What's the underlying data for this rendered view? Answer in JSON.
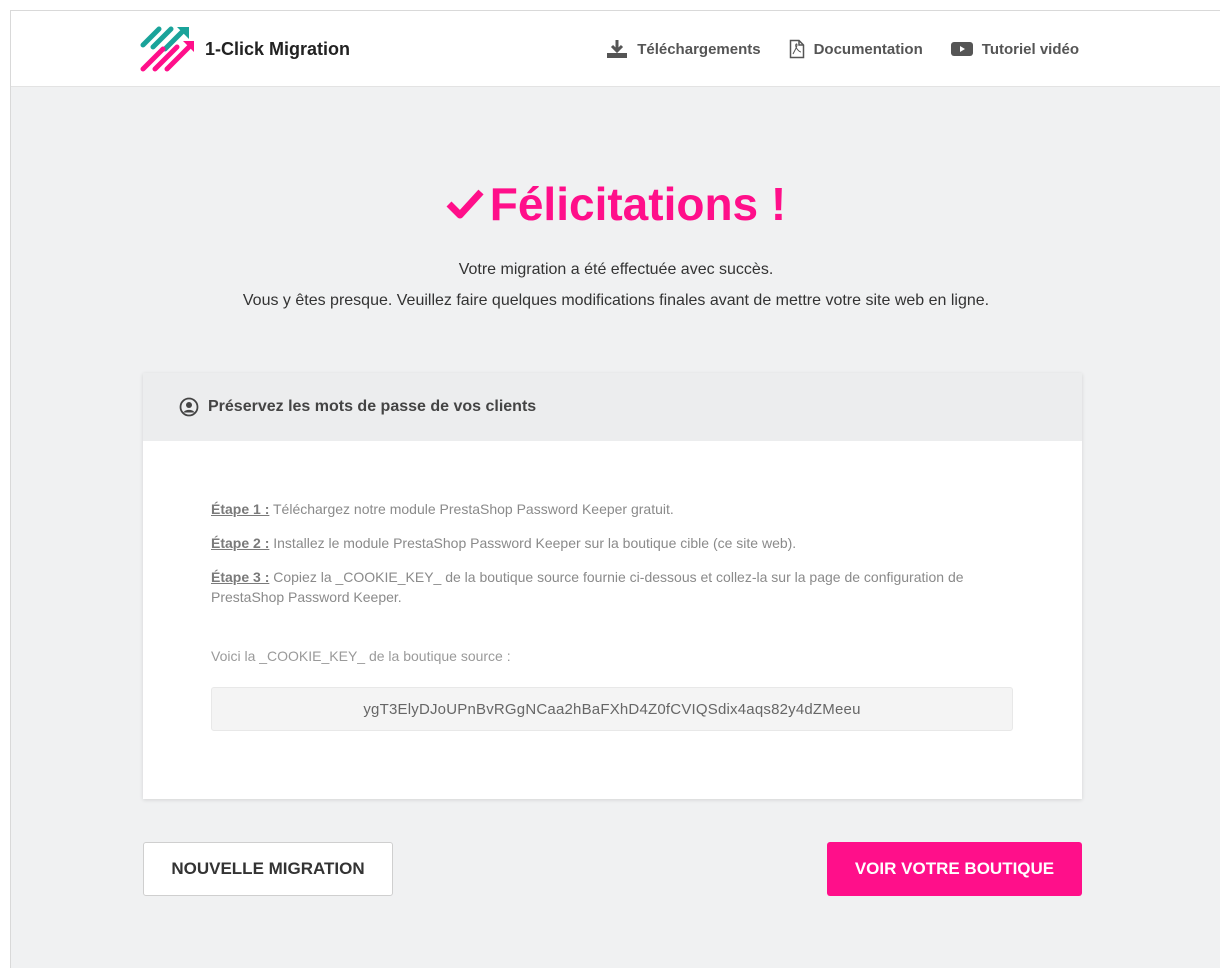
{
  "brand": {
    "name": "1-Click Migration",
    "logo_icon": "migration-arrows-logo"
  },
  "nav": {
    "items": [
      {
        "label": "Téléchargements",
        "icon": "download-icon"
      },
      {
        "label": "Documentation",
        "icon": "pdf-document-icon"
      },
      {
        "label": "Tutoriel vidéo",
        "icon": "video-play-icon"
      }
    ]
  },
  "hero": {
    "title": "Félicitations !",
    "title_icon": "checkmark-icon",
    "line1": "Votre migration a été effectuée avec succès.",
    "line2": "Vous y êtes presque. Veuillez faire quelques modifications finales avant de mettre votre site web en ligne."
  },
  "card": {
    "title": "Préservez les mots de passe de vos clients",
    "title_icon": "user-circle-icon",
    "steps": [
      {
        "label": "Étape 1 :",
        "text": " Téléchargez notre module PrestaShop Password Keeper gratuit."
      },
      {
        "label": "Étape 2 :",
        "text": " Installez le module PrestaShop Password Keeper sur la boutique cible (ce site web)."
      },
      {
        "label": "Étape 3 :",
        "text": " Copiez la _COOKIE_KEY_ de la boutique source fournie ci-dessous et collez-la sur la page de configuration de PrestaShop Password Keeper."
      }
    ],
    "cookie_label": "Voici la _COOKIE_KEY_ de la boutique source :",
    "cookie_value": "ygT3ElyDJoUPnBvRGgNCaa2hBaFXhD4Z0fCVIQSdix4aqs82y4dZMeeu"
  },
  "actions": {
    "new_migration": "NOUVELLE MIGRATION",
    "view_shop": "VOIR VOTRE BOUTIQUE"
  },
  "colors": {
    "accent": "#ff0f8a",
    "logo_teal": "#1aa39a",
    "background": "#f0f1f2"
  }
}
